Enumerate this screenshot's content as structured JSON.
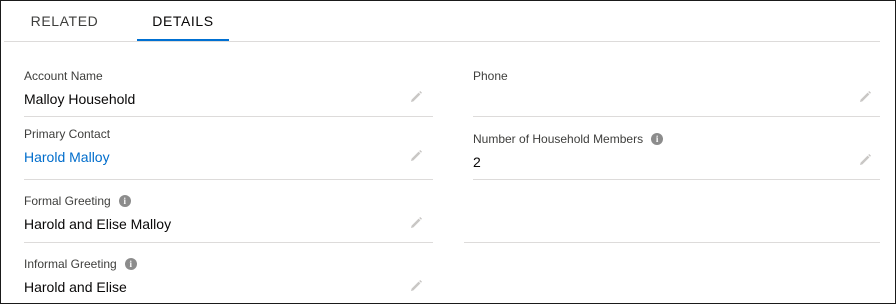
{
  "tabs": {
    "related": "RELATED",
    "details": "DETAILS"
  },
  "fields": {
    "account_name": {
      "label": "Account Name",
      "value": "Malloy Household"
    },
    "phone": {
      "label": "Phone",
      "value": ""
    },
    "primary_contact": {
      "label": "Primary Contact",
      "value": "Harold Malloy"
    },
    "household_members": {
      "label": "Number of Household Members",
      "value": "2"
    },
    "formal_greeting": {
      "label": "Formal Greeting",
      "value": "Harold and Elise Malloy"
    },
    "informal_greeting": {
      "label": "Informal Greeting",
      "value": "Harold and Elise"
    }
  },
  "icons": {
    "edit": "pencil-icon",
    "info": "info-icon",
    "info_glyph": "i"
  },
  "colors": {
    "active_tab_underline": "#0070d2",
    "link": "#006dcc",
    "divider": "#dddbda"
  }
}
